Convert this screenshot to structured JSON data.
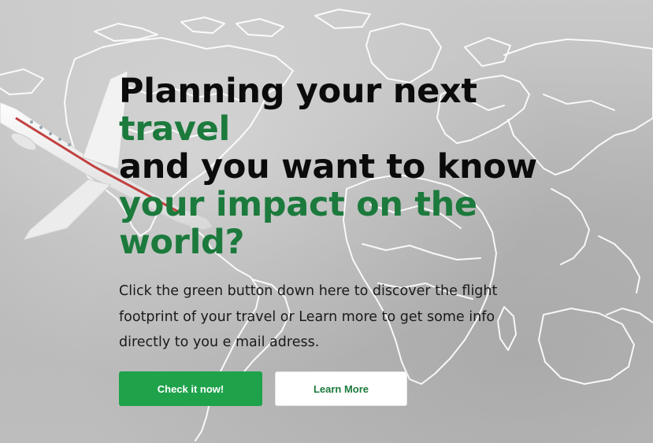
{
  "hero": {
    "headline_line1": "Planning your next",
    "headline_line2": "travel",
    "headline_line3": "and you want to know",
    "headline_line4": "your impact on the",
    "headline_line5": "world?",
    "description": "Click the green button down here to discover the flight footprint of your travel or Learn more to get some info directly to you e mail adress."
  },
  "actions": {
    "primary_label": "Check it now!",
    "secondary_label": "Learn More"
  },
  "colors": {
    "accent_green": "#1ea24a",
    "headline_green": "#1b7a3c",
    "headline_dark": "#0b0b0b",
    "background_gray": "#bdbdbd"
  },
  "icons": {
    "background_map": "world-map-outline",
    "background_plane": "airplane-model"
  }
}
